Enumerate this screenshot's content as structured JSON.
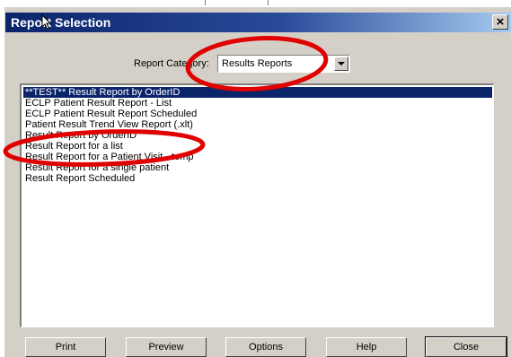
{
  "dialog": {
    "title": "Report Selection",
    "close_label": "×"
  },
  "category": {
    "label": "Report Category:",
    "selected": "Results Reports"
  },
  "reports": [
    "**TEST** Result Report by OrderID",
    "ECLP Patient Result Report - List",
    "ECLP Patient Result Report Scheduled",
    "Patient Result Trend View Report (.xlt)",
    "Result Report by OrderID",
    "Result Report for a list",
    "Result Report for a Patient Visit - temp",
    "Result Report for a single patient",
    "Result Report Scheduled"
  ],
  "selected_index": 0,
  "buttons": {
    "print": "Print",
    "preview": "Preview",
    "options": "Options",
    "help": "Help",
    "close": "Close"
  },
  "colors": {
    "title_bar": "#0a246a",
    "selection": "#0a246a",
    "annotation": "#e00000"
  }
}
